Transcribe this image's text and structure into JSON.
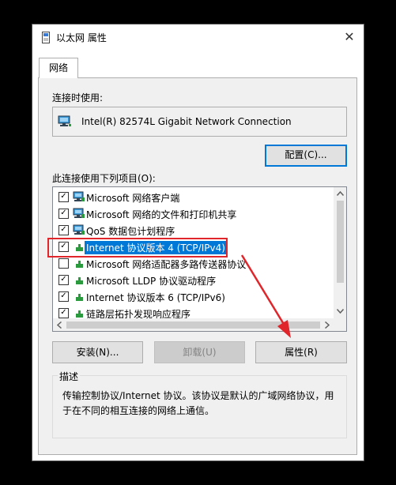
{
  "window": {
    "title": "以太网 属性",
    "close_glyph": "✕"
  },
  "tabs": [
    {
      "label": "网络"
    }
  ],
  "connect_using": {
    "label": "连接时使用:",
    "adapter_name": "Intel(R) 82574L Gigabit Network Connection",
    "configure_label": "配置(C)..."
  },
  "items_section": {
    "label": "此连接使用下列项目(O):",
    "items": [
      {
        "label": "Microsoft 网络客户端",
        "checked": true,
        "icon": "network-client-icon"
      },
      {
        "label": "Microsoft 网络的文件和打印机共享",
        "checked": true,
        "icon": "network-client-icon"
      },
      {
        "label": "QoS 数据包计划程序",
        "checked": true,
        "icon": "network-client-icon"
      },
      {
        "label": "Internet 协议版本 4 (TCP/IPv4)",
        "checked": true,
        "icon": "protocol-icon",
        "selected": true
      },
      {
        "label": "Microsoft 网络适配器多路传送器协议",
        "checked": false,
        "icon": "protocol-icon"
      },
      {
        "label": "Microsoft LLDP 协议驱动程序",
        "checked": true,
        "icon": "protocol-icon"
      },
      {
        "label": "Internet 协议版本 6 (TCP/IPv6)",
        "checked": true,
        "icon": "protocol-icon"
      },
      {
        "label": "链路层拓扑发现响应程序",
        "checked": true,
        "icon": "protocol-icon"
      }
    ]
  },
  "buttons": {
    "install": "安装(N)...",
    "uninstall": "卸载(U)",
    "properties": "属性(R)"
  },
  "description": {
    "legend": "描述",
    "text": "传输控制协议/Internet 协议。该协议是默认的广域网络协议，用于在不同的相互连接的网络上通信。"
  },
  "colors": {
    "selection": "#0078d7",
    "annotation": "#e0262b",
    "background": "#f0f0f0"
  }
}
